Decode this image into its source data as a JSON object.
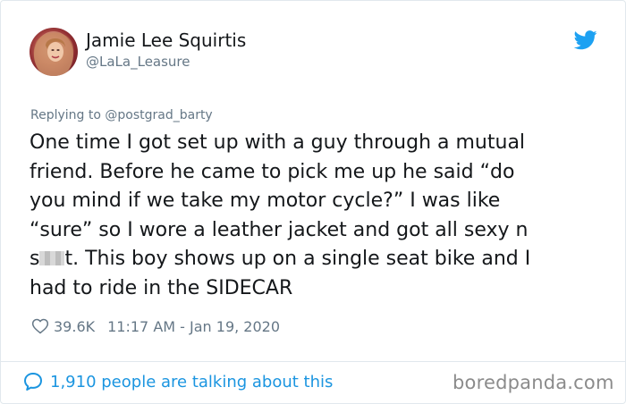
{
  "tweet": {
    "author": {
      "display_name": "Jamie Lee Squirtis",
      "handle": "@LaLa_Leasure"
    },
    "reply_to": "Replying to @postgrad_barty",
    "text_lines": [
      "One time I got set up with a guy through a mutual",
      "friend. Before he came to pick me up he said “do",
      "you mind if we take my motor cycle?” I was like",
      "“sure” so I wore a leather jacket and got all sexy n",
      {
        "before": "s",
        "after": "t. This boy shows up on a single seat bike and I"
      },
      "had to ride in the SIDECAR"
    ],
    "likes": "39.6K",
    "timestamp": "11:17 AM - Jan 19, 2020",
    "talking": "1,910 people are talking about this"
  },
  "watermark": "boredpanda.com",
  "icons": {
    "brand": "twitter-bird-icon",
    "like": "heart-icon",
    "conversation": "speech-bubble-icon"
  },
  "colors": {
    "twitter_blue": "#1da1f2",
    "link_blue": "#1b95e0",
    "secondary_text": "#657786",
    "primary_text": "#14171a",
    "border": "#e1e8ed"
  }
}
